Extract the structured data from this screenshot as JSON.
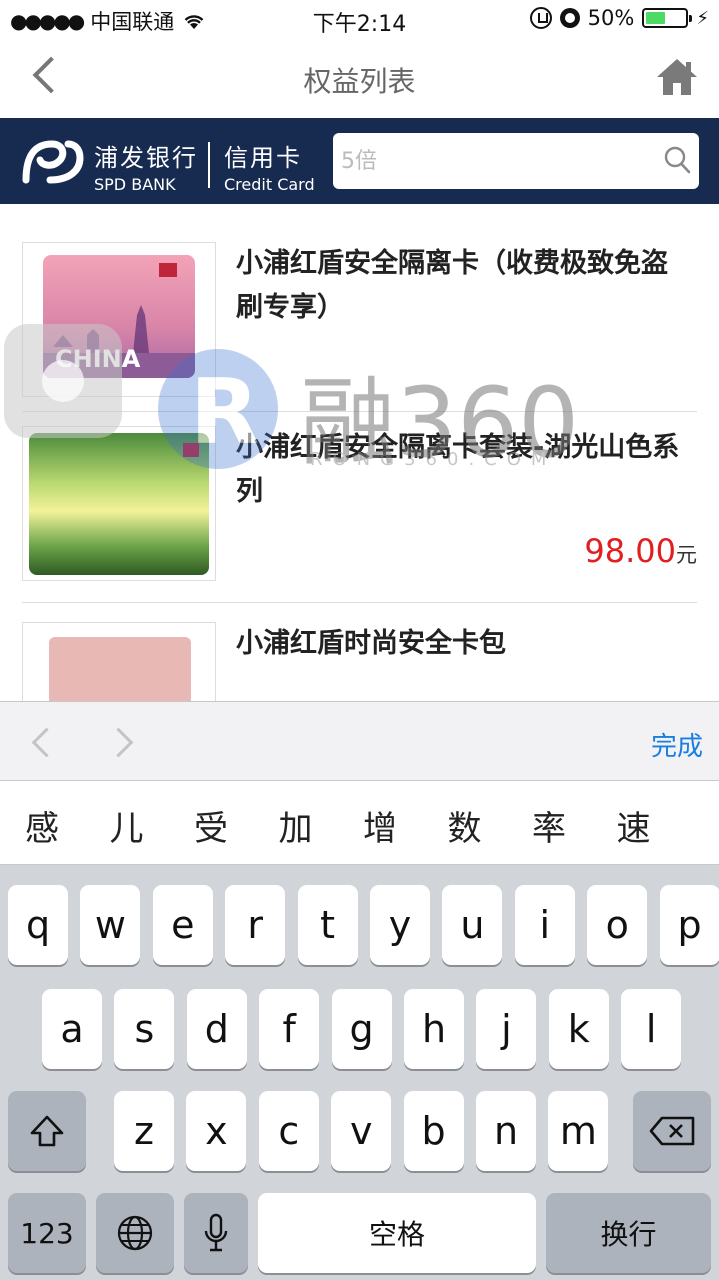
{
  "status_bar": {
    "carrier": "中国联通",
    "time": "下午2:14",
    "battery": "50%",
    "battery_level": 0.5
  },
  "nav": {
    "title": "权益列表"
  },
  "brand": {
    "bank_zh": "浦发银行",
    "bank_en": "SPD BANK",
    "card_zh": "信用卡",
    "card_en": "Credit Card"
  },
  "search": {
    "placeholder": "5倍"
  },
  "products": [
    {
      "title": "小浦红盾安全隔离卡（收费极致免盗刷专享）",
      "price": "",
      "unit": "",
      "card_label": "CHINA"
    },
    {
      "title": "小浦红盾安全隔离卡套装-湖光山色系列",
      "price": "98.00",
      "unit": "元"
    },
    {
      "title": "小浦红盾时尚安全卡包",
      "price": "",
      "unit": ""
    }
  ],
  "watermark": {
    "text": "融360",
    "sub": "RONG360.COM"
  },
  "keyboard": {
    "done": "完成",
    "candidates": [
      "感",
      "儿",
      "受",
      "加",
      "增",
      "数",
      "率",
      "速"
    ],
    "row1": [
      "q",
      "w",
      "e",
      "r",
      "t",
      "y",
      "u",
      "i",
      "o",
      "p"
    ],
    "row2": [
      "a",
      "s",
      "d",
      "f",
      "g",
      "h",
      "j",
      "k",
      "l"
    ],
    "row3": [
      "z",
      "x",
      "c",
      "v",
      "b",
      "n",
      "m"
    ],
    "num_key": "123",
    "space": "空格",
    "return": "换行"
  },
  "colors": {
    "brand_bg": "#172a50",
    "price": "#e02020",
    "done": "#1a7ee0",
    "battery_fill": "#4cd964"
  }
}
